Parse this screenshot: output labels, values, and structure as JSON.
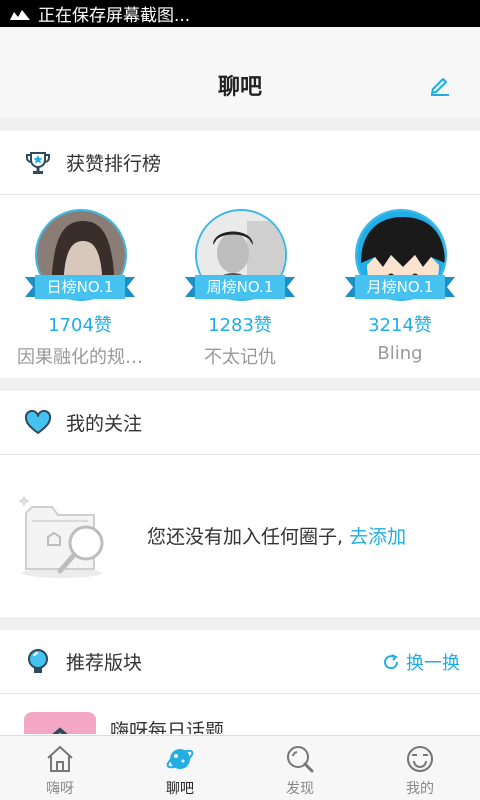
{
  "status_bar": {
    "text": "正在保存屏幕截图..."
  },
  "header": {
    "title": "聊吧"
  },
  "ranking": {
    "title": "获赞排行榜",
    "items": [
      {
        "badge": "日榜NO.1",
        "likes": "1704赞",
        "name": "因果融化的规…"
      },
      {
        "badge": "周榜NO.1",
        "likes": "1283赞",
        "name": "不太记仇"
      },
      {
        "badge": "月榜NO.1",
        "likes": "3214赞",
        "name": "Bling"
      }
    ]
  },
  "follow": {
    "title": "我的关注",
    "empty_text": "您还没有加入任何圈子,",
    "add_link": "去添加"
  },
  "recommend": {
    "title": "推荐版块",
    "refresh": "换一换",
    "first_board": "嗨呀每日话题"
  },
  "tabs": [
    {
      "label": "嗨呀",
      "icon": "home-icon"
    },
    {
      "label": "聊吧",
      "icon": "planet-icon",
      "active": true
    },
    {
      "label": "发现",
      "icon": "discover-search-icon"
    },
    {
      "label": "我的",
      "icon": "smiley-face-icon"
    }
  ],
  "colors": {
    "accent": "#20aee5",
    "ribbon_light": "#45c2ef",
    "ribbon_dark": "#1e8fc4"
  }
}
